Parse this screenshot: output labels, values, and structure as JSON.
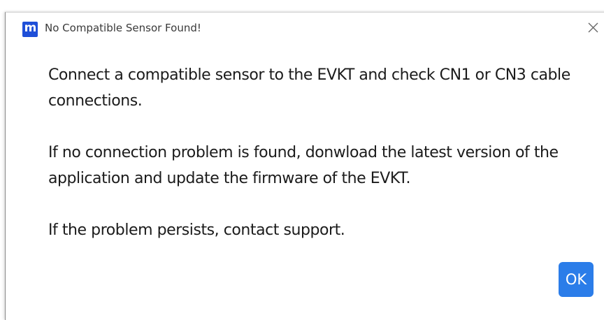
{
  "window": {
    "title": "No Compatible Sensor Found!",
    "app_icon_glyph": "m",
    "app_icon_name": "app-logo-icon",
    "close_icon_name": "close-icon"
  },
  "message": {
    "paragraphs": [
      "Connect a compatible sensor to the EVKT and check CN1 or CN3 cable connections.",
      "If no connection problem is found, donwload the latest version of the application and update the firmware of the EVKT.",
      "If the problem persists, contact support."
    ]
  },
  "buttons": {
    "ok_label": "OK"
  },
  "colors": {
    "accent": "#2b7de9",
    "app_icon": "#1f4fd8"
  }
}
